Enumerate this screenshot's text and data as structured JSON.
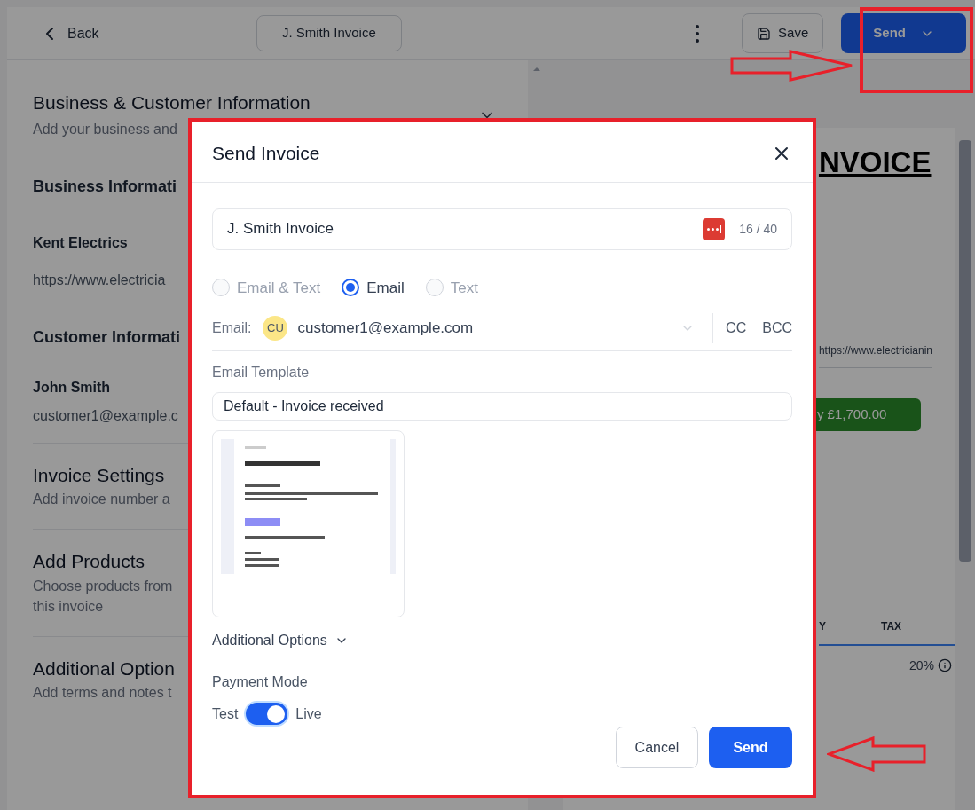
{
  "topbar": {
    "back": "Back",
    "title": "J. Smith Invoice",
    "save": "Save",
    "send": "Send"
  },
  "editor": {
    "header": {
      "title": "Business & Customer Information",
      "subtitle": "Add your business and",
      "expanded": true
    },
    "groups": [
      {
        "title": "Business Informati",
        "lines": [
          {
            "text": "Kent Electrics",
            "bold": true
          },
          {
            "text": "https://www.electricia",
            "bold": false
          }
        ]
      },
      {
        "title": "Customer Informati",
        "lines": [
          {
            "text": "John Smith",
            "bold": true
          },
          {
            "text": "customer1@example.c",
            "bold": false
          }
        ]
      }
    ],
    "sections": [
      {
        "title": "Invoice Settings",
        "subtitle_lines": [
          "Add invoice number a"
        ]
      },
      {
        "title": "Add Products",
        "subtitle_lines": [
          "Choose products from",
          "this invoice"
        ]
      },
      {
        "title": "Additional Option",
        "subtitle_lines": [
          "Add terms and notes t"
        ]
      }
    ]
  },
  "preview": {
    "title": "NVOICE",
    "website": "https://www.electricianin",
    "pay_button": "y £1,700.00",
    "columns": [
      "Y",
      "TAX"
    ],
    "tax": "20%"
  },
  "modal": {
    "title": "Send Invoice",
    "name_field": {
      "value": "J. Smith Invoice",
      "counter": "16 / 40"
    },
    "channels": [
      {
        "label": "Email & Text",
        "selected": false,
        "disabled": true
      },
      {
        "label": "Email",
        "selected": true,
        "disabled": false
      },
      {
        "label": "Text",
        "selected": false,
        "disabled": true
      }
    ],
    "recipient": {
      "label": "Email:",
      "initials": "CU",
      "value": "customer1@example.com",
      "cc": "CC",
      "bcc": "BCC"
    },
    "template": {
      "label": "Email Template",
      "value": "Default - Invoice received"
    },
    "additional_options": {
      "label": "Additional Options",
      "expanded": false
    },
    "payment_mode": {
      "label": "Payment Mode",
      "off_label": "Test",
      "on_label": "Live",
      "on": true
    },
    "buttons": {
      "cancel": "Cancel",
      "send": "Send"
    }
  }
}
